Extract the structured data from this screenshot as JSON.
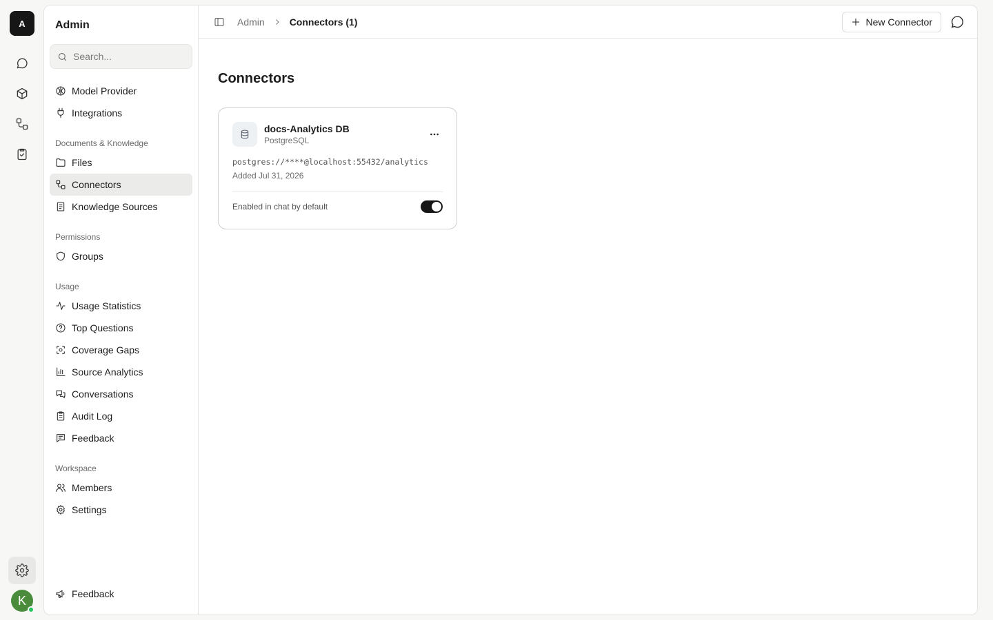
{
  "rail": {
    "logo_letter": "A",
    "items": [
      {
        "icon": "chat-bubble-icon"
      },
      {
        "icon": "cube-icon"
      },
      {
        "icon": "connectors-icon"
      },
      {
        "icon": "clipboard-check-icon"
      }
    ],
    "settings_icon": "gear-icon",
    "avatar_letter": "K",
    "avatar_color": "#4a8c3c",
    "online_color": "#22c55e"
  },
  "sidebar": {
    "title": "Admin",
    "search": {
      "placeholder": "Search...",
      "value": ""
    },
    "top_items": [
      {
        "label": "Model Provider",
        "icon": "brain-icon"
      },
      {
        "label": "Integrations",
        "icon": "plug-icon"
      }
    ],
    "sections": [
      {
        "label": "Documents & Knowledge",
        "items": [
          {
            "label": "Files",
            "icon": "folder-icon"
          },
          {
            "label": "Connectors",
            "icon": "connectors-icon",
            "active": true
          },
          {
            "label": "Knowledge Sources",
            "icon": "book-icon"
          }
        ]
      },
      {
        "label": "Permissions",
        "items": [
          {
            "label": "Groups",
            "icon": "shield-icon"
          }
        ]
      },
      {
        "label": "Usage",
        "items": [
          {
            "label": "Usage Statistics",
            "icon": "activity-icon"
          },
          {
            "label": "Top Questions",
            "icon": "question-circle-icon"
          },
          {
            "label": "Coverage Gaps",
            "icon": "scan-icon"
          },
          {
            "label": "Source Analytics",
            "icon": "bar-chart-icon"
          },
          {
            "label": "Conversations",
            "icon": "chat-bubbles-icon"
          },
          {
            "label": "Audit Log",
            "icon": "clipboard-list-icon"
          },
          {
            "label": "Feedback",
            "icon": "message-square-icon"
          }
        ]
      },
      {
        "label": "Workspace",
        "items": [
          {
            "label": "Members",
            "icon": "users-icon"
          },
          {
            "label": "Settings",
            "icon": "gear-icon"
          }
        ]
      }
    ],
    "footer": {
      "label": "Feedback",
      "icon": "megaphone-icon"
    }
  },
  "topbar": {
    "breadcrumb_root": "Admin",
    "breadcrumb_current": "Connectors (1)",
    "new_button_label": "New Connector"
  },
  "main": {
    "title": "Connectors",
    "connectors": [
      {
        "name": "docs-Analytics DB",
        "type": "PostgreSQL",
        "url": "postgres://****@localhost:55432/analytics",
        "added": "Added Jul 31, 2026",
        "toggle_label": "Enabled in chat by default",
        "enabled": true
      }
    ]
  },
  "colors": {
    "accent_dark": "#161616",
    "active_item_bg": "#ebebea",
    "page_bg": "#f7f7f6"
  }
}
